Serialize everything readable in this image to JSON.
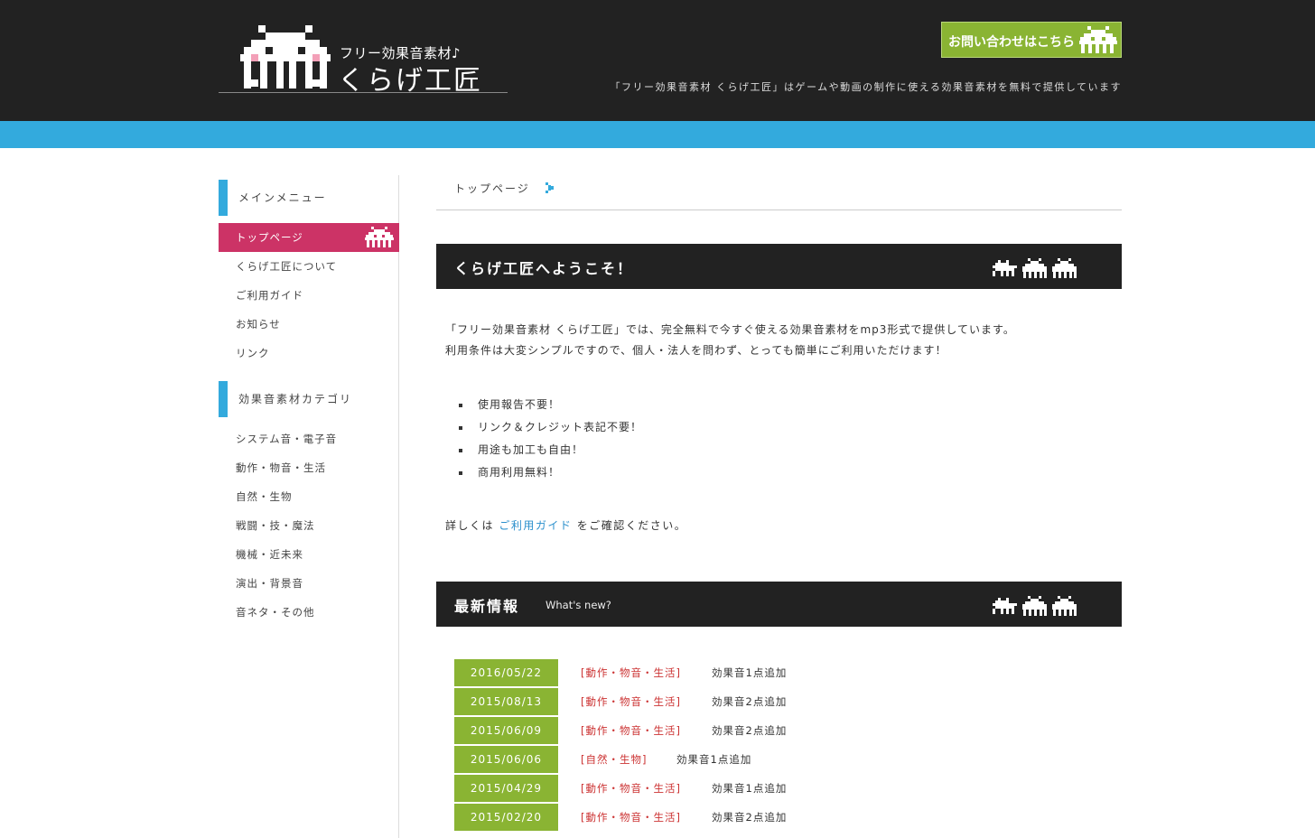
{
  "header": {
    "logo_sub": "フリー効果音素材♪",
    "logo_main": "くらげ工匠",
    "contact_button": "お問い合わせはこちら",
    "tagline": "「フリー効果音素材 くらげ工匠」はゲームや動画の制作に使える効果音素材を無料で提供しています"
  },
  "sidebar": {
    "main_menu_heading": "メインメニュー",
    "main_menu": [
      {
        "label": "トップページ",
        "active": true
      },
      {
        "label": "くらげ工匠について"
      },
      {
        "label": "ご利用ガイド"
      },
      {
        "label": "お知らせ"
      },
      {
        "label": "リンク"
      }
    ],
    "category_heading": "効果音素材カテゴリ",
    "categories": [
      {
        "label": "システム音・電子音"
      },
      {
        "label": "動作・物音・生活"
      },
      {
        "label": "自然・生物"
      },
      {
        "label": "戦闘・技・魔法"
      },
      {
        "label": "機械・近未来"
      },
      {
        "label": "演出・背景音"
      },
      {
        "label": "音ネタ・その他"
      }
    ]
  },
  "breadcrumb": {
    "current": "トップページ"
  },
  "welcome": {
    "title": "くらげ工匠へようこそ！",
    "intro_line1": "「フリー効果音素材 くらげ工匠」では、完全無料で今すぐ使える効果音素材をmp3形式で提供しています。",
    "intro_line2": "利用条件は大変シンプルですので、個人・法人を問わず、とっても簡単にご利用いただけます！",
    "features": [
      "使用報告不要！",
      "リンク＆クレジット表記不要！",
      "用途も加工も自由！",
      "商用利用無料！"
    ],
    "detail_prefix": "詳しくは",
    "detail_link": "ご利用ガイド",
    "detail_suffix": "をご確認ください。"
  },
  "news": {
    "title": "最新情報",
    "subtitle": "What's new?",
    "items": [
      {
        "date": "2016/05/22",
        "category": "[動作・物音・生活]",
        "text": "効果音1点追加"
      },
      {
        "date": "2015/08/13",
        "category": "[動作・物音・生活]",
        "text": "効果音2点追加"
      },
      {
        "date": "2015/06/09",
        "category": "[動作・物音・生活]",
        "text": "効果音2点追加"
      },
      {
        "date": "2015/06/06",
        "category": "[自然・生物]",
        "text": "効果音1点追加"
      },
      {
        "date": "2015/04/29",
        "category": "[動作・物音・生活]",
        "text": "効果音1点追加"
      },
      {
        "date": "2015/02/20",
        "category": "[動作・物音・生活]",
        "text": "効果音2点追加"
      }
    ]
  },
  "icons": {
    "logo": "jellyfish-invader-icon",
    "contact": "jellyfish-invader-icon",
    "breadcrumb": "pixel-arrow-icon",
    "section": "invader-trio-icon"
  },
  "colors": {
    "header_bg": "#222222",
    "accent_blue": "#33aadd",
    "active_pink": "#cc3366",
    "green": "#8ab433",
    "category_red": "#cc3333"
  }
}
